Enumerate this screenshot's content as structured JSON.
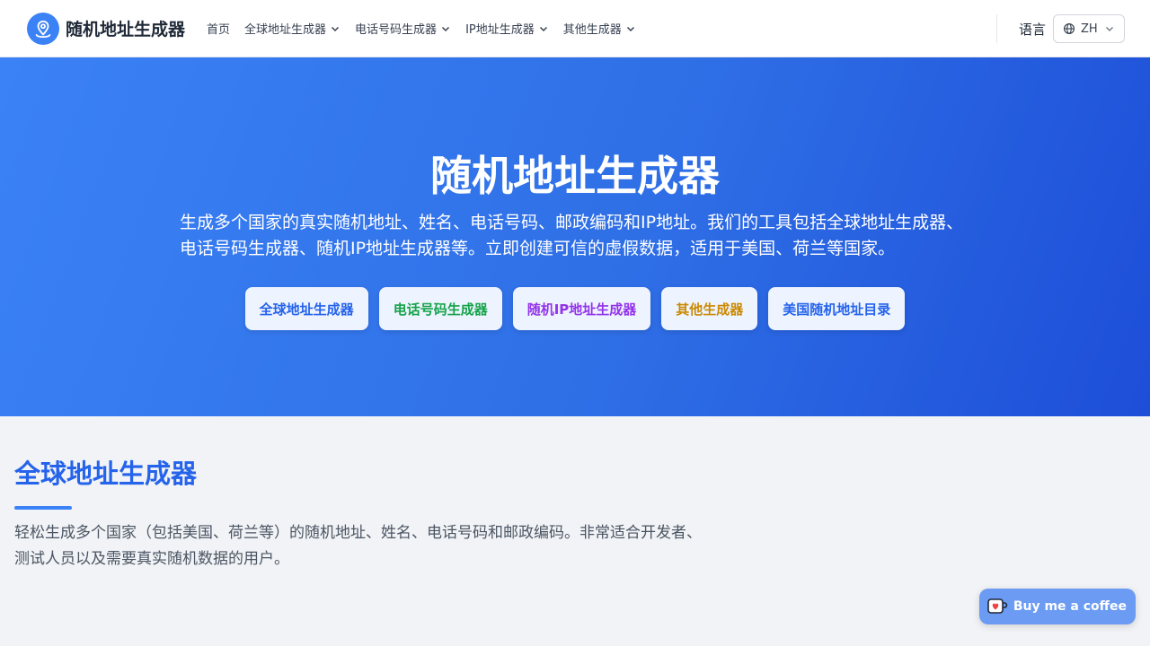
{
  "header": {
    "logo_text": "随机地址生成器",
    "nav": [
      {
        "label": "首页",
        "dropdown": false
      },
      {
        "label": "全球地址生成器",
        "dropdown": true
      },
      {
        "label": "电话号码生成器",
        "dropdown": true
      },
      {
        "label": "IP地址生成器",
        "dropdown": true
      },
      {
        "label": "其他生成器",
        "dropdown": true
      }
    ],
    "language_label": "语言",
    "language_code": "ZH"
  },
  "hero": {
    "title": "随机地址生成器",
    "description": "生成多个国家的真实随机地址、姓名、电话号码、邮政编码和IP地址。我们的工具包括全球地址生成器、电话号码生成器、随机IP地址生成器等。立即创建可信的虚假数据，适用于美国、荷兰等国家。",
    "buttons": [
      {
        "label": "全球地址生成器",
        "color": "#2563eb"
      },
      {
        "label": "电话号码生成器",
        "color": "#16a34a"
      },
      {
        "label": "随机IP地址生成器",
        "color": "#9333ea"
      },
      {
        "label": "其他生成器",
        "color": "#ca8a04"
      },
      {
        "label": "美国随机地址目录",
        "color": "#2563eb"
      }
    ]
  },
  "section": {
    "title": "全球地址生成器",
    "description": "轻松生成多个国家（包括美国、荷兰等）的随机地址、姓名、电话号码和邮政编码。非常适合开发者、测试人员以及需要真实随机数据的用户。"
  },
  "coffee": {
    "label": "Buy me a coffee"
  },
  "colors": {
    "accent": "#3b82f6",
    "hero_end": "#1d4ed8",
    "section_title": "#2563eb"
  }
}
